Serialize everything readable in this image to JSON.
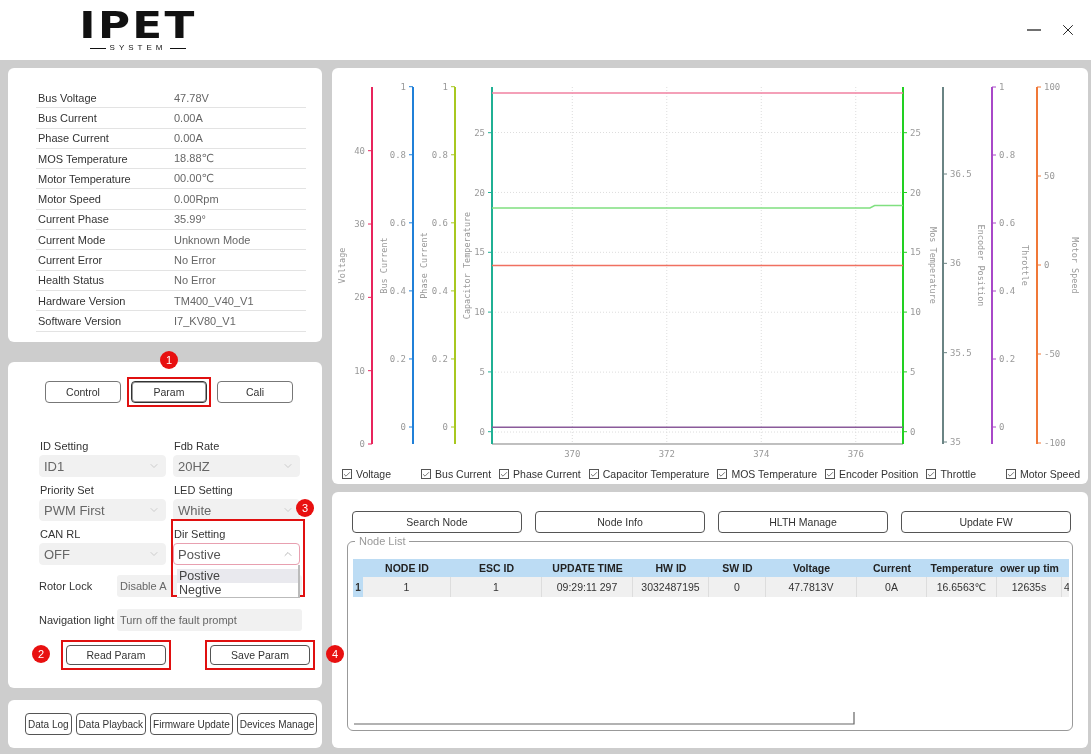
{
  "logo": {
    "title": "IPET",
    "subtitle": "SYSTEM"
  },
  "status": {
    "rows": [
      {
        "label": "Bus Voltage",
        "value": "47.78V"
      },
      {
        "label": "Bus Current",
        "value": "0.00A"
      },
      {
        "label": "Phase Current",
        "value": "0.00A"
      },
      {
        "label": "MOS Temperature",
        "value": "18.88℃"
      },
      {
        "label": "Motor Temperature",
        "value": "00.00℃"
      },
      {
        "label": "Motor Speed",
        "value": "0.00Rpm"
      },
      {
        "label": "Current Phase",
        "value": "35.99°"
      },
      {
        "label": "Current Mode",
        "value": "Unknown Mode"
      },
      {
        "label": "Current Error",
        "value": "No Error"
      },
      {
        "label": "Health Status",
        "value": "No Error"
      },
      {
        "label": "Hardware Version",
        "value": "TM400_V40_V1"
      },
      {
        "label": "Software Version",
        "value": "I7_KV80_V1"
      }
    ]
  },
  "param_panel": {
    "tabs": [
      {
        "label": "Control",
        "selected": false
      },
      {
        "label": "Param",
        "selected": true,
        "callout": "1"
      },
      {
        "label": "Cali",
        "selected": false
      }
    ],
    "settings": [
      {
        "label": "ID Setting",
        "value": "ID1",
        "open": false
      },
      {
        "label": "Fdb Rate",
        "value": "20HZ",
        "open": false
      },
      {
        "label": "Priority Set",
        "value": "PWM First",
        "open": false
      },
      {
        "label": "LED Setting",
        "value": "White",
        "open": false
      },
      {
        "label": "CAN RL",
        "value": "OFF",
        "open": false
      },
      {
        "label": "Dir Setting",
        "value": "Postive",
        "open": true,
        "callout": "3",
        "options": [
          {
            "label": "Postive",
            "selected": true
          },
          {
            "label": "Negtive",
            "selected": false
          }
        ]
      }
    ],
    "rows": [
      {
        "label": "Rotor Lock",
        "value": "Disable A"
      },
      {
        "label": "Navigation light",
        "value": "Turn off the fault prompt"
      }
    ],
    "buttons": [
      {
        "label": "Read Param",
        "callout": "2"
      },
      {
        "label": "Save Param",
        "callout": "4"
      }
    ]
  },
  "tools": [
    "Data Log",
    "Data Playback",
    "Firmware Update",
    "Devices Manage"
  ],
  "chart": {
    "axes": [
      {
        "label": "Voltage",
        "color": "#e8245c",
        "ticks": [
          "40",
          "30",
          "20",
          "10",
          "0"
        ]
      },
      {
        "label": "Bus Current",
        "color": "#2080d8",
        "ticks": [
          "1",
          "0.8",
          "0.6",
          "0.4",
          "0.2",
          "0"
        ]
      },
      {
        "label": "Phase Current",
        "color": "#a8c820",
        "ticks": [
          "1",
          "0.8",
          "0.6",
          "0.4",
          "0.2",
          "0"
        ]
      },
      {
        "label": "Capacitor Temperature",
        "color": "#20b094",
        "ticks": [
          "25",
          "20",
          "15",
          "10",
          "5",
          "0"
        ]
      },
      {
        "label": "Mos Temperature",
        "color": "#22d022",
        "ticks": [
          "25",
          "20",
          "15",
          "10",
          "5",
          "0"
        ]
      },
      {
        "label": "Encoder Position",
        "color": "#6a8484",
        "ticks": [
          "36.5",
          "36",
          "35.5",
          "35"
        ]
      },
      {
        "label": "Throttle",
        "color": "#a848c8",
        "ticks": [
          "1",
          "0.8",
          "0.6",
          "0.4",
          "0.2",
          "0"
        ]
      },
      {
        "label": "Motor Speed",
        "color": "#f07838",
        "ticks": [
          "100",
          "50",
          "0",
          "-50",
          "-100"
        ]
      }
    ],
    "chart_data": {
      "type": "line",
      "grid": true,
      "x": [
        368.3,
        376.3,
        376.4,
        377.0
      ],
      "xlim": [
        368.3,
        377.0
      ],
      "ylim": [
        -1,
        28.8
      ],
      "xticks": [
        370,
        372,
        374,
        376
      ],
      "yticks": [
        0,
        5,
        10,
        15,
        20,
        25
      ],
      "series": [
        {
          "color": "#f080a0",
          "values": [
            28.3,
            28.3,
            28.3,
            28.3
          ]
        },
        {
          "color": "#80e080",
          "values": [
            18.7,
            18.7,
            18.9,
            18.9
          ]
        },
        {
          "color": "#f07060",
          "values": [
            13.9,
            13.9,
            13.9,
            13.9
          ]
        },
        {
          "color": "#8a5a9a",
          "values": [
            0.4,
            0.4,
            0.4,
            0.4
          ]
        }
      ]
    },
    "legend": [
      {
        "label": "Voltage",
        "checked": true
      },
      {
        "label": "Bus Current",
        "checked": true
      },
      {
        "label": "Phase Current",
        "checked": true
      },
      {
        "label": "Capacitor Temperature",
        "checked": true
      },
      {
        "label": "MOS Temperature",
        "checked": true
      },
      {
        "label": "Encoder Position",
        "checked": true
      },
      {
        "label": "Throttle",
        "checked": true
      },
      {
        "label": "Motor Speed",
        "checked": true
      }
    ]
  },
  "nodes": {
    "buttons": [
      "Search Node",
      "Node Info",
      "HLTH Manage",
      "Update FW"
    ],
    "group_title": "Node List",
    "table": {
      "columns": [
        "NODE ID",
        "ESC ID",
        "UPDATE TIME",
        "HW ID",
        "SW ID",
        "Voltage",
        "Current",
        "Temperature",
        "ower up tim"
      ],
      "rows": [
        {
          "number": "1",
          "cells": [
            "1",
            "1",
            "09:29:11 297",
            "3032487195",
            "0",
            "47.7813V",
            "0A",
            "16.6563℃",
            "12635s",
            "4"
          ]
        }
      ]
    }
  }
}
